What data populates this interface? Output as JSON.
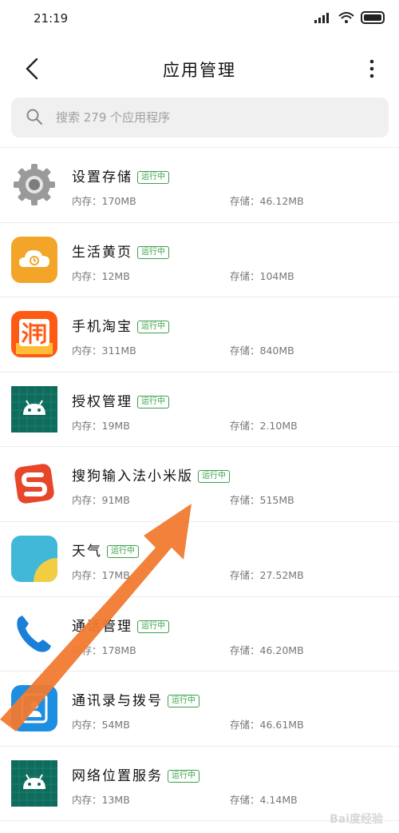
{
  "status_bar": {
    "time": "21:19"
  },
  "header": {
    "title": "应用管理"
  },
  "search": {
    "placeholder": "搜索 279 个应用程序"
  },
  "labels": {
    "memory": "内存：",
    "storage": "存储："
  },
  "apps": [
    {
      "name": "设置存储",
      "badge": "运行中",
      "memory": "内存：170MB",
      "storage": "存储：46.12MB",
      "icon": "settings-gear-icon"
    },
    {
      "name": "生活黄页",
      "badge": "运行中",
      "memory": "内存：12MB",
      "storage": "存储：104MB",
      "icon": "yellow-pages-icon"
    },
    {
      "name": "手机淘宝",
      "badge": "运行中",
      "memory": "内存：311MB",
      "storage": "存储：840MB",
      "icon": "taobao-icon"
    },
    {
      "name": "授权管理",
      "badge": "运行中",
      "memory": "内存：19MB",
      "storage": "存储：2.10MB",
      "icon": "android-icon"
    },
    {
      "name": "搜狗输入法小米版",
      "badge": "运行中",
      "memory": "内存：91MB",
      "storage": "存储：515MB",
      "icon": "sogou-icon"
    },
    {
      "name": "天气",
      "badge": "运行中",
      "memory": "内存：17MB",
      "storage": "存储：27.52MB",
      "icon": "weather-icon"
    },
    {
      "name": "通话管理",
      "badge": "运行中",
      "memory": "内存：178MB",
      "storage": "存储：46.20MB",
      "icon": "phone-icon"
    },
    {
      "name": "通讯录与拨号",
      "badge": "运行中",
      "memory": "内存：54MB",
      "storage": "存储：46.61MB",
      "icon": "contacts-icon"
    },
    {
      "name": "网络位置服务",
      "badge": "运行中",
      "memory": "内存：13MB",
      "storage": "存储：4.14MB",
      "icon": "android-icon"
    }
  ],
  "watermark": "Bai度经验",
  "colors": {
    "badge_green": "#3aa14c",
    "arrow_orange": "#f07a30"
  }
}
